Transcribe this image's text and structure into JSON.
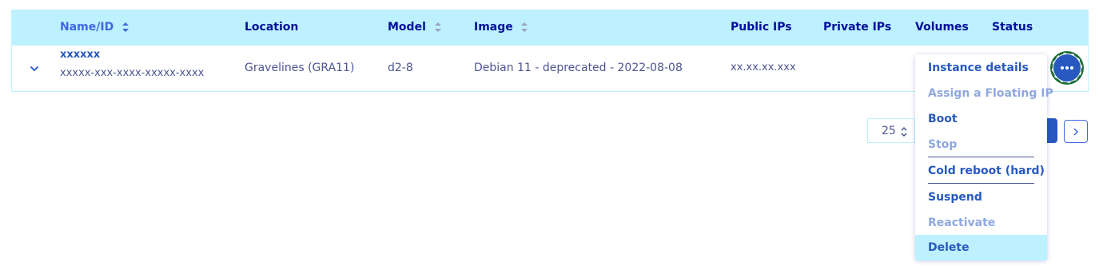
{
  "table": {
    "headers": {
      "name_id": "Name/ID",
      "location": "Location",
      "model": "Model",
      "image": "Image",
      "public_ips": "Public IPs",
      "private_ips": "Private IPs",
      "volumes": "Volumes",
      "status": "Status"
    },
    "row": {
      "name": "xxxxxx",
      "id": "xxxxx-xxx-xxxx-xxxxx-xxxx",
      "location": "Gravelines (GRA11)",
      "model": "d2-8",
      "image": "Debian 11 - deprecated - 2022-08-08",
      "public_ip": "xx.xx.xx.xxx"
    }
  },
  "pagination": {
    "page_size": "25"
  },
  "action_menu": {
    "items": [
      {
        "label": "Instance details",
        "enabled": true
      },
      {
        "label": "Assign a Floating IP",
        "enabled": false
      },
      {
        "label": "Boot",
        "enabled": true
      },
      {
        "label": "Stop",
        "enabled": false
      },
      {
        "label": "Cold reboot (hard)",
        "enabled": true
      },
      {
        "label": "Suspend",
        "enabled": true
      },
      {
        "label": "Reactivate",
        "enabled": false
      },
      {
        "label": "Delete",
        "enabled": true,
        "highlighted": true
      }
    ]
  },
  "colors": {
    "header_bg": "#bef1ff",
    "primary": "#2859c0",
    "heading_text": "#000e9c",
    "body_text": "#4d5592",
    "disabled_text": "#8fa8df"
  }
}
